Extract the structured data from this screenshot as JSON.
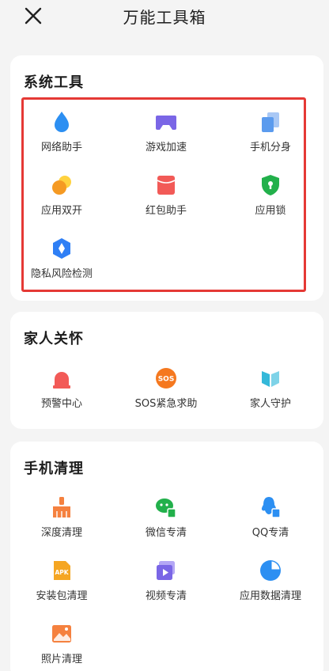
{
  "header": {
    "title": "万能工具箱"
  },
  "sections": {
    "system": {
      "title": "系统工具",
      "items": [
        {
          "label": "网络助手",
          "icon": "water-drop-icon"
        },
        {
          "label": "游戏加速",
          "icon": "gamepad-icon"
        },
        {
          "label": "手机分身",
          "icon": "clone-icon"
        },
        {
          "label": "应用双开",
          "icon": "dual-coin-icon"
        },
        {
          "label": "红包助手",
          "icon": "red-envelope-icon"
        },
        {
          "label": "应用锁",
          "icon": "shield-lock-icon"
        },
        {
          "label": "隐私风险检测",
          "icon": "privacy-detect-icon"
        }
      ]
    },
    "family": {
      "title": "家人关怀",
      "items": [
        {
          "label": "预警中心",
          "icon": "alarm-light-icon"
        },
        {
          "label": "SOS紧急求助",
          "icon": "sos-icon"
        },
        {
          "label": "家人守护",
          "icon": "family-guard-icon"
        }
      ]
    },
    "clean": {
      "title": "手机清理",
      "items": [
        {
          "label": "深度清理",
          "icon": "broom-icon"
        },
        {
          "label": "微信专清",
          "icon": "wechat-clean-icon"
        },
        {
          "label": "QQ专清",
          "icon": "qq-clean-icon"
        },
        {
          "label": "安装包清理",
          "icon": "apk-icon",
          "badge": "APK"
        },
        {
          "label": "视频专清",
          "icon": "video-icon"
        },
        {
          "label": "应用数据清理",
          "icon": "pie-chart-icon"
        },
        {
          "label": "照片清理",
          "icon": "photo-icon"
        }
      ]
    }
  },
  "colors": {
    "highlight": "#e53935",
    "blue": "#2c8ff2",
    "purple": "#7a66e6",
    "orange": "#f59a23",
    "red": "#f25a57",
    "green": "#22b04b",
    "teal": "#34b8d9"
  }
}
